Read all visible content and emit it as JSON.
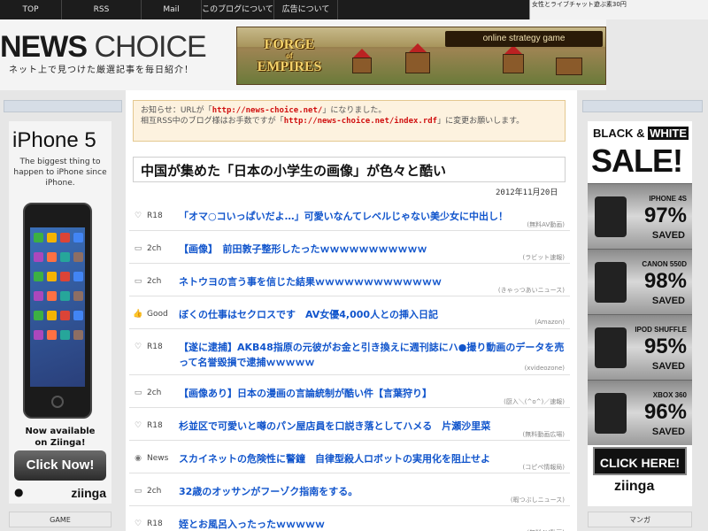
{
  "nav": {
    "items": [
      "TOP",
      "RSS",
      "Mail",
      "このブログについて",
      "広告について"
    ],
    "ticker": "女性とライブチャット遊ぶ素30円"
  },
  "header": {
    "logo_bold": "NEWS",
    "logo_light": "CHOICE",
    "tagline": "ネット上で見つけた厳選記事を毎日紹介！",
    "banner": {
      "game_line1": "FORGE",
      "game_line2": "of",
      "game_line3": "EMPIRES",
      "tag": "online strategy game"
    }
  },
  "notice": {
    "line1_prefix": "お知らせ：URLが「",
    "url1": "http://news-choice.net/",
    "line1_suffix": "」になりました。",
    "line2_prefix": "相互RSS中のブログ様はお手数ですが「",
    "url2": "http://news-choice.net/index.rdf",
    "line2_suffix": "」に変更お願いします。"
  },
  "article": {
    "title": "中国が集めた「日本の小学生の画像」が色々と酷い",
    "date": "2012年11月20日"
  },
  "list": [
    {
      "cat": "R18",
      "icon": "♡",
      "icon_name": "heart-icon",
      "title": "「オマ○コいっぱいだよ…」可愛いなんてレベルじゃない美少女に中出し！",
      "src": "(無料AV動画)"
    },
    {
      "cat": "2ch",
      "icon": "▭",
      "icon_name": "monitor-icon",
      "title": "【画像】　前田敦子整形したったｗｗｗｗｗｗｗｗｗｗｗ",
      "src": "(ラビット速報)"
    },
    {
      "cat": "2ch",
      "icon": "▭",
      "icon_name": "monitor-icon",
      "title": "ネトウヨの言う事を信じた結果ｗｗｗｗｗｗｗｗｗｗｗｗｗ",
      "src": "(きゃっつあいニュース)"
    },
    {
      "cat": "Good",
      "icon": "👍",
      "icon_name": "thumbs-up-icon",
      "title": "ぼくの仕事はセクロスです　AV女優4,000人との挿入日記",
      "src": "(Amazon)"
    },
    {
      "cat": "R18",
      "icon": "♡",
      "icon_name": "heart-icon",
      "title": "【遂に逮捕】AKB48指原の元彼がお金と引き換えに週刊誌にハ●撮り動画のデータを売って名誉毀損で逮捕ｗｗｗｗｗ",
      "src": "(xvideozone)"
    },
    {
      "cat": "2ch",
      "icon": "▭",
      "icon_name": "monitor-icon",
      "title": "【画像あり】日本の漫画の言論統制が酷い件【言葉狩り】",
      "src": "(厨入＼(^o^)／速報)"
    },
    {
      "cat": "R18",
      "icon": "♡",
      "icon_name": "heart-icon",
      "title": "杉並区で可愛いと噂のパン屋店員を口説き落としてハメる　片瀬沙里菜",
      "src": "(無料動画広場)"
    },
    {
      "cat": "News",
      "icon": "◉",
      "icon_name": "broadcast-icon",
      "title": "スカイネットの危険性に警鐘　自律型殺人ロボットの実用化を阻止せよ",
      "src": "(コピペ情報局)"
    },
    {
      "cat": "2ch",
      "icon": "▭",
      "icon_name": "monitor-icon",
      "title": "32歳のオッサンがフーゾク指南をする。",
      "src": "(暇つぶしニュース)"
    },
    {
      "cat": "R18",
      "icon": "♡",
      "icon_name": "heart-icon",
      "title": "姪とお風呂入ったったｗｗｗｗｗ",
      "src": "(無料AV動画)"
    }
  ],
  "ad_left": {
    "model": "iPhone 5",
    "sub": "The biggest thing to happen to iPhone since iPhone.",
    "avail_line1": "Now available",
    "avail_line2": "on Ziinga!",
    "cta": "Click Now!",
    "brand": "ziinga"
  },
  "ad_right": {
    "head_black": "BLACK",
    "head_amp": "&",
    "head_white": "WHITE",
    "sale": "SALE!",
    "products": [
      {
        "name": "IPHONE 4S",
        "pct": "97%",
        "saved": "SAVED"
      },
      {
        "name": "CANON 550D",
        "pct": "98%",
        "saved": "SAVED"
      },
      {
        "name": "IPOD SHUFFLE",
        "pct": "95%",
        "saved": "SAVED"
      },
      {
        "name": "XBOX 360",
        "pct": "96%",
        "saved": "SAVED"
      }
    ],
    "cta": "CLICK HERE!",
    "brand": "ziinga"
  },
  "sections": {
    "left_label": "GAME",
    "right_label": "マンガ"
  }
}
